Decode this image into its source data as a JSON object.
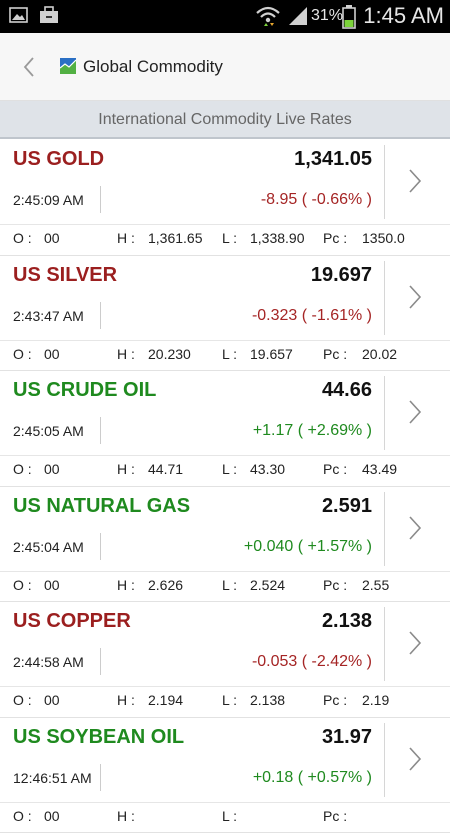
{
  "status_bar": {
    "battery_percent": "31%",
    "time": "1:45 AM",
    "icons": [
      "image-icon",
      "briefcase-icon",
      "wifi-icon",
      "signal-icon",
      "battery-icon"
    ]
  },
  "app_bar": {
    "title": "Global Commodity",
    "icons": [
      "back-icon",
      "chart-logo-icon"
    ]
  },
  "subheader": "International Commodity Live Rates",
  "colors": {
    "up": "#1f8a1f",
    "down": "#a52525",
    "subheader_bg": "#dfe3e8"
  },
  "items": [
    {
      "name": "US GOLD",
      "price": "1,341.05",
      "time": "2:45:09 AM",
      "change": "-8.95 ( -0.66% )",
      "direction": "down",
      "o_label": "O :",
      "o": "00",
      "h_label": "H :",
      "h": "1,361.65",
      "l_label": "L :",
      "l": "1,338.90",
      "pc_label": "Pc :",
      "pc": "1350.0"
    },
    {
      "name": "US SILVER",
      "price": "19.697",
      "time": "2:43:47 AM",
      "change": "-0.323 ( -1.61% )",
      "direction": "down",
      "o_label": "O :",
      "o": "00",
      "h_label": "H :",
      "h": "20.230",
      "l_label": "L :",
      "l": "19.657",
      "pc_label": "Pc :",
      "pc": "20.02"
    },
    {
      "name": "US CRUDE OIL",
      "price": "44.66",
      "time": "2:45:05 AM",
      "change": "+1.17 ( +2.69% )",
      "direction": "up",
      "o_label": "O :",
      "o": "00",
      "h_label": "H :",
      "h": "44.71",
      "l_label": "L :",
      "l": "43.30",
      "pc_label": "Pc :",
      "pc": "43.49"
    },
    {
      "name": "US NATURAL GAS",
      "price": "2.591",
      "time": "2:45:04 AM",
      "change": "+0.040 ( +1.57% )",
      "direction": "up",
      "o_label": "O :",
      "o": "00",
      "h_label": "H :",
      "h": "2.626",
      "l_label": "L :",
      "l": "2.524",
      "pc_label": "Pc :",
      "pc": "2.55"
    },
    {
      "name": "US COPPER",
      "price": "2.138",
      "time": "2:44:58 AM",
      "change": "-0.053 ( -2.42% )",
      "direction": "down",
      "o_label": "O :",
      "o": "00",
      "h_label": "H :",
      "h": "2.194",
      "l_label": "L :",
      "l": "2.138",
      "pc_label": "Pc :",
      "pc": "2.19"
    },
    {
      "name": "US SOYBEAN OIL",
      "price": "31.97",
      "time": "12:46:51 AM",
      "change": "+0.18 ( +0.57% )",
      "direction": "up",
      "o_label": "O :",
      "o": "00",
      "h_label": "H :",
      "h": "",
      "l_label": "L :",
      "l": "",
      "pc_label": "Pc :",
      "pc": ""
    }
  ]
}
